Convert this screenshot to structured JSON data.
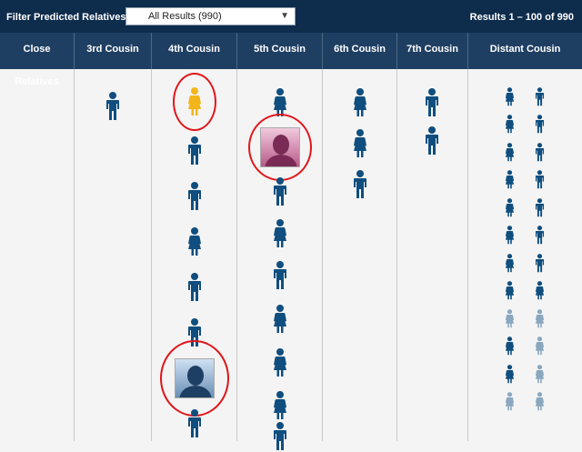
{
  "toolbar": {
    "filter_label": "Filter Predicted Relatives:",
    "filter_value": "All Results (990)",
    "results_text": "Results 1 – 100 of 990"
  },
  "columns": [
    {
      "key": "close",
      "label": "Close Relatives"
    },
    {
      "key": "c3",
      "label": "3rd Cousin"
    },
    {
      "key": "c4",
      "label": "4th Cousin"
    },
    {
      "key": "c5",
      "label": "5th Cousin"
    },
    {
      "key": "c6",
      "label": "6th Cousin"
    },
    {
      "key": "c7",
      "label": "7th Cousin"
    },
    {
      "key": "distant",
      "label": "Distant Cousin"
    }
  ],
  "colors": {
    "topbar": "#0e2c4c",
    "header": "#1f3f62",
    "figure_navy": "#0f4e7e",
    "figure_light": "#8aa7c0",
    "figure_highlight": "#f3b51a",
    "annotation_red": "#e0161b"
  },
  "relatives": {
    "c3": [
      {
        "icon": "male-person-icon"
      }
    ],
    "c4": [
      {
        "icon": "female-person-icon",
        "highlight": true,
        "circled": true
      },
      {
        "icon": "male-person-icon"
      },
      {
        "icon": "male-person-icon"
      },
      {
        "icon": "female-person-icon"
      },
      {
        "icon": "male-person-icon"
      },
      {
        "icon": "male-person-icon"
      },
      {
        "icon": "male-photo-avatar",
        "circled": true
      },
      {
        "icon": "male-person-icon"
      }
    ],
    "c5": [
      {
        "icon": "female-person-icon"
      },
      {
        "icon": "female-photo-avatar",
        "circled": true
      },
      {
        "icon": "male-person-icon"
      },
      {
        "icon": "female-person-icon"
      },
      {
        "icon": "male-person-icon"
      },
      {
        "icon": "female-person-icon"
      },
      {
        "icon": "female-person-icon"
      },
      {
        "icon": "female-person-icon"
      },
      {
        "icon": "male-person-icon"
      }
    ],
    "c6": [
      {
        "icon": "female-person-icon"
      },
      {
        "icon": "female-person-icon"
      },
      {
        "icon": "male-person-icon"
      }
    ],
    "c7": [
      {
        "icon": "male-person-icon"
      },
      {
        "icon": "male-person-icon"
      }
    ],
    "distant_left": [
      "female",
      "female",
      "female",
      "female",
      "female",
      "female",
      "female",
      "female",
      "female-light",
      "female",
      "female",
      "female-light"
    ],
    "distant_right": [
      "male",
      "male",
      "male",
      "male",
      "male",
      "male",
      "male",
      "female",
      "female-light",
      "female-light",
      "female-light",
      "female-light"
    ]
  }
}
